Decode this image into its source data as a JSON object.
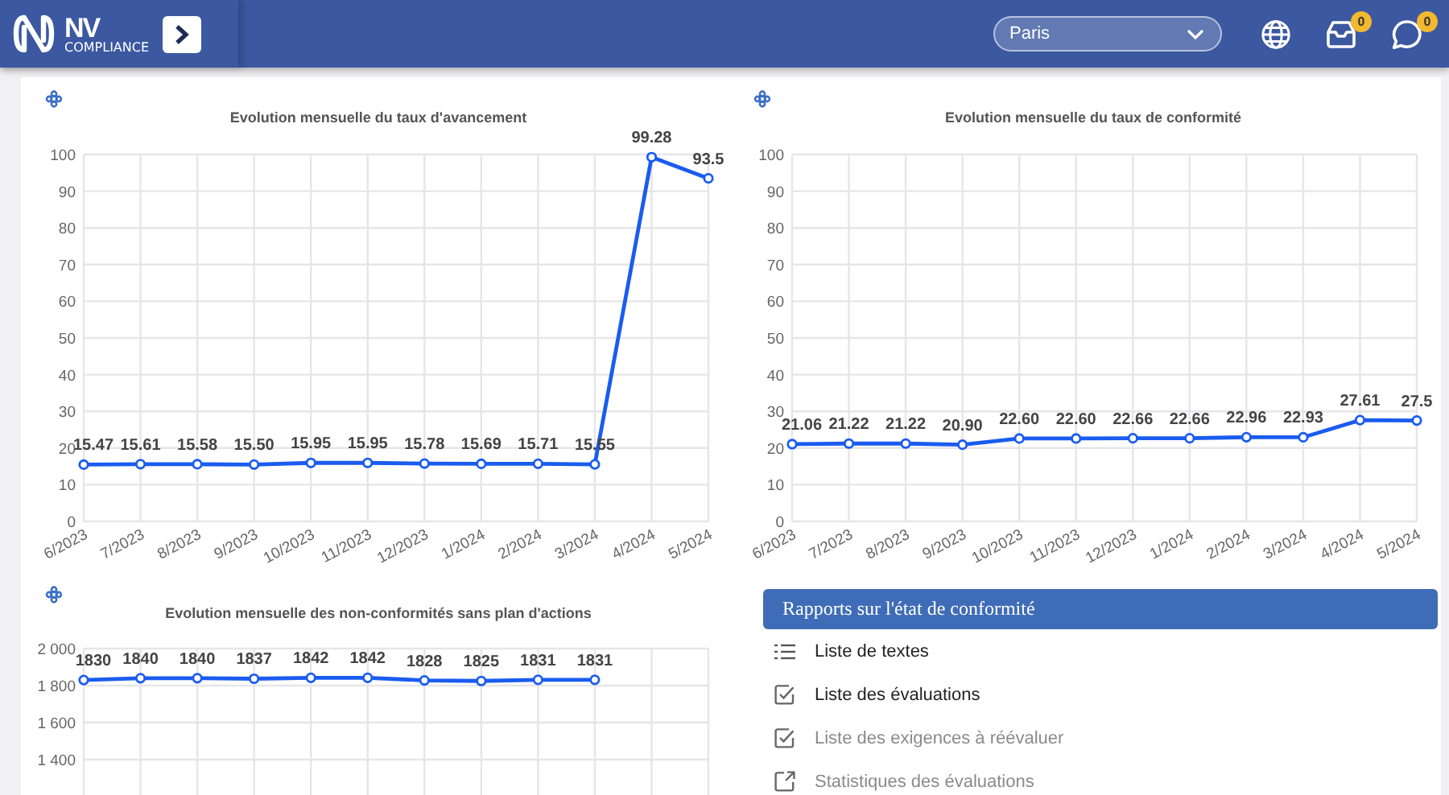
{
  "header": {
    "logo": {
      "title": "NV",
      "subtitle": "COMPLIANCE"
    },
    "site_select": {
      "value": "Paris"
    },
    "notifications": [
      {
        "kind": "inbox",
        "count": "0"
      },
      {
        "kind": "chat",
        "count": "0"
      }
    ]
  },
  "charts": [
    {
      "chart_data": {
        "type": "line",
        "title": "Evolution mensuelle du taux d'avancement",
        "categories": [
          "6/2023",
          "7/2023",
          "8/2023",
          "9/2023",
          "10/2023",
          "11/2023",
          "12/2023",
          "1/2024",
          "2/2024",
          "3/2024",
          "4/2024",
          "5/2024"
        ],
        "grid": true,
        "series": [
          {
            "marker": true,
            "color": "#1a5cf0",
            "values": [
              15.47,
              15.61,
              15.58,
              15.5,
              15.95,
              15.95,
              15.78,
              15.69,
              15.71,
              15.55,
              99.28,
              93.5
            ]
          }
        ],
        "value_labels": [
          "15.47",
          "15.61",
          "15.58",
          "15.50",
          "15.95",
          "15.95",
          "15.78",
          "15.69",
          "15.71",
          "15.55",
          "99.28",
          "93.5"
        ],
        "ylim": [
          0,
          100
        ],
        "yticks": [
          0,
          10,
          20,
          30,
          40,
          50,
          60,
          70,
          80,
          90,
          100
        ]
      }
    },
    {
      "chart_data": {
        "type": "line",
        "title": "Evolution mensuelle du taux de conformité",
        "categories": [
          "6/2023",
          "7/2023",
          "8/2023",
          "9/2023",
          "10/2023",
          "11/2023",
          "12/2023",
          "1/2024",
          "2/2024",
          "3/2024",
          "4/2024",
          "5/2024"
        ],
        "grid": true,
        "series": [
          {
            "marker": true,
            "color": "#1a5cf0",
            "values": [
              21.06,
              21.22,
              21.22,
              20.9,
              22.6,
              22.6,
              22.66,
              22.66,
              22.96,
              22.93,
              27.61,
              27.5
            ]
          }
        ],
        "value_labels": [
          "21.06",
          "21.22",
          "21.22",
          "20.90",
          "22.60",
          "22.60",
          "22.66",
          "22.66",
          "22.96",
          "22.93",
          "27.61",
          "27.5"
        ],
        "ylim": [
          0,
          100
        ],
        "yticks": [
          0,
          10,
          20,
          30,
          40,
          50,
          60,
          70,
          80,
          90,
          100
        ]
      }
    },
    {
      "chart_data": {
        "type": "line",
        "title": "Evolution mensuelle des non-conformités sans plan d'actions",
        "grid": true,
        "series": [
          {
            "marker": true,
            "color": "#1a5cf0",
            "values": [
              1830,
              1840,
              1840,
              1837,
              1842,
              1842,
              1828,
              1825,
              1831,
              1831,
              null,
              null
            ]
          }
        ],
        "value_labels": [
          "1830",
          "1840",
          "1840",
          "1837",
          "1842",
          "1842",
          "1828",
          "1825",
          "1831",
          "1831"
        ],
        "ylim": [
          1200,
          2000
        ],
        "yticks": [
          {
            "value": 1400,
            "label": "1 400"
          },
          {
            "value": 1600,
            "label": "1 600"
          },
          {
            "value": 1800,
            "label": "1 800"
          },
          {
            "value": 2000,
            "label": "2 000"
          }
        ]
      }
    }
  ],
  "reports": {
    "title": "Rapports sur l'état de conformité",
    "items": [
      {
        "kind": "list",
        "label": "Liste de textes",
        "disabled": false
      },
      {
        "kind": "check",
        "label": "Liste des évaluations",
        "disabled": false
      },
      {
        "kind": "check",
        "label": "Liste des exigences à réévaluer",
        "disabled": true
      },
      {
        "kind": "link",
        "label": "Statistiques des évaluations",
        "disabled": true
      }
    ]
  }
}
